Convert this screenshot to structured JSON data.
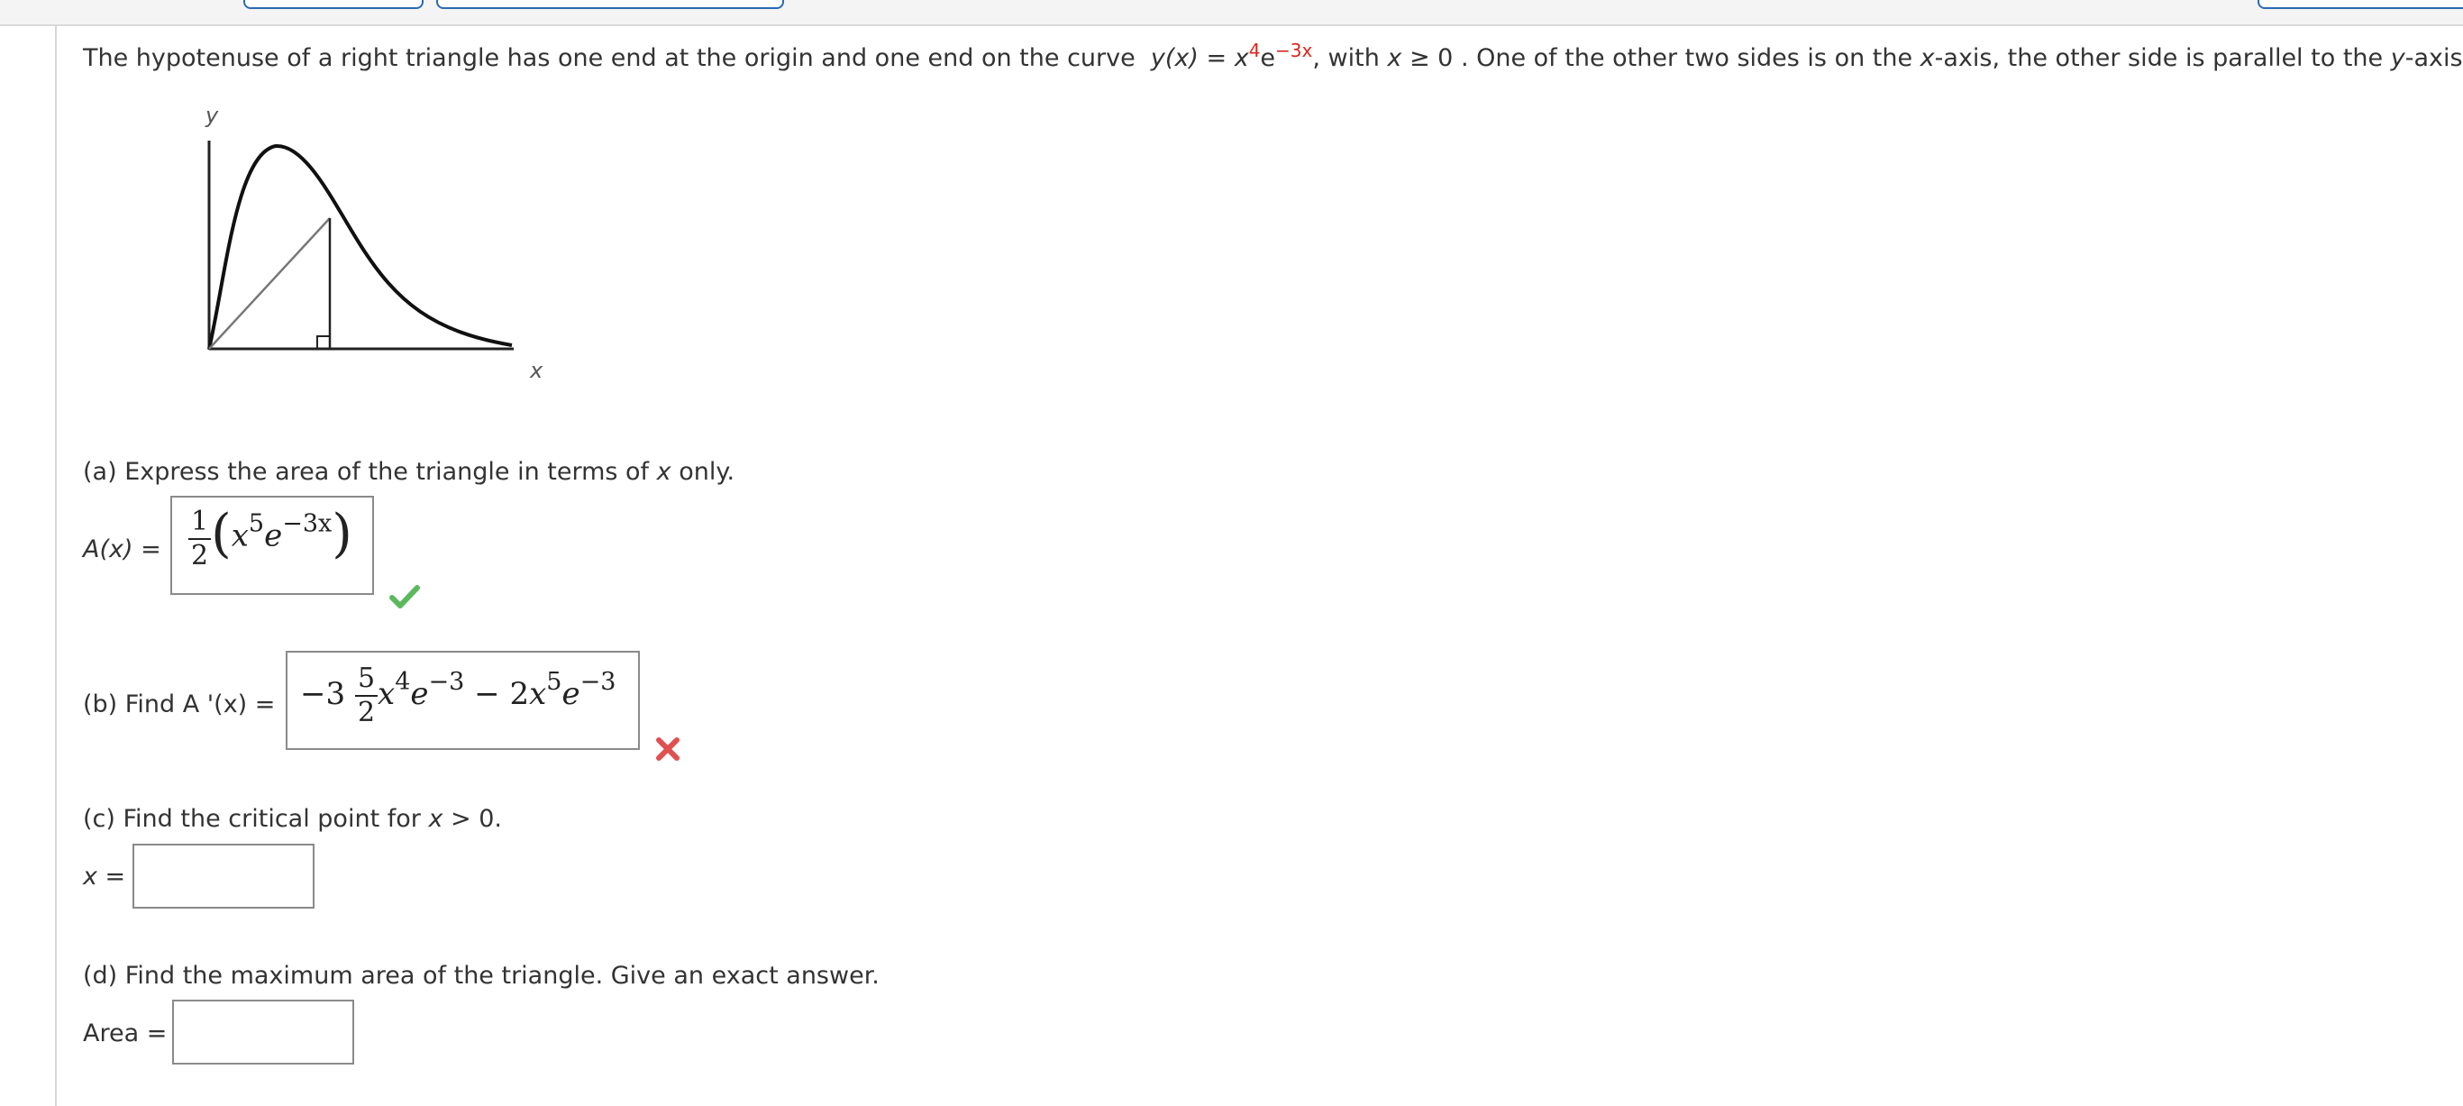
{
  "problem": {
    "intro": "The hypotenuse of a right triangle has one end at the origin and one end on the curve",
    "curve_lhs": "y(x) = x",
    "curve_exp1": "4",
    "curve_e": "e",
    "curve_exp2": "−3x",
    "curve_tail_a": ", with ",
    "curve_tail_x": "x",
    "curve_tail_b": " ≥ 0 . One of the other two sides is on the ",
    "axis_x": "x",
    "curve_tail_c": "-axis, the other side is parallel to the ",
    "axis_y": "y",
    "curve_tail_d": "-axis."
  },
  "figure": {
    "y_label": "y",
    "x_label": "x"
  },
  "part_a": {
    "prompt_pre": "(a) Express the area of the triangle in terms of ",
    "prompt_var": "x",
    "prompt_post": " only.",
    "label": "A(x) =",
    "answer": {
      "num": "1",
      "den": "2",
      "open": "(",
      "x": "x",
      "exp1": "5",
      "e": "e",
      "exp2": "−3x",
      "close": ")"
    },
    "status": "correct"
  },
  "part_b": {
    "prompt": "(b) Find A '(x) =",
    "answer": {
      "lead": "−3",
      "num": "5",
      "den": "2",
      "x1": "x",
      "exp1": "4",
      "e1": "e",
      "exp2": "−3",
      "minus": "−",
      "coef": "2",
      "x2": "x",
      "exp3": "5",
      "e2": "e",
      "exp4": "−3"
    },
    "status": "incorrect"
  },
  "part_c": {
    "prompt_pre": "(c) Find the critical point for ",
    "prompt_var": "x",
    "prompt_post": " > 0.",
    "label": "x =",
    "value": ""
  },
  "part_d": {
    "prompt": "(d) Find the maximum area of the triangle. Give an exact answer.",
    "label": "Area =",
    "value": ""
  },
  "colors": {
    "accent_red": "#d9281e",
    "correct_green": "#5cb85c",
    "wrong_red": "#e05050",
    "tab_border": "#2a6ab3"
  }
}
